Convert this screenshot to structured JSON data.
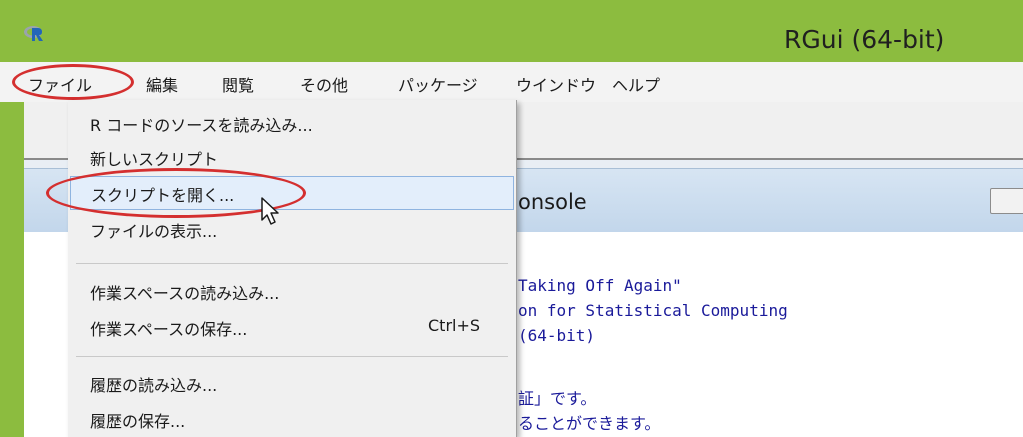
{
  "window": {
    "title": "RGui (64-bit)"
  },
  "menubar": {
    "items": [
      "ファイル",
      "編集",
      "閲覧",
      "その他",
      "パッケージ",
      "ウインドウ",
      "ヘルプ"
    ]
  },
  "file_menu": {
    "items": [
      {
        "label": "R コードのソースを読み込み...",
        "shortcut": ""
      },
      {
        "label": "新しいスクリプト",
        "shortcut": ""
      },
      {
        "label": "スクリプトを開く...",
        "shortcut": ""
      },
      {
        "label": "ファイルの表示...",
        "shortcut": ""
      },
      {
        "label": "作業スペースの読み込み...",
        "shortcut": ""
      },
      {
        "label": "作業スペースの保存...",
        "shortcut": "Ctrl+S"
      },
      {
        "label": "履歴の読み込み...",
        "shortcut": ""
      },
      {
        "label": "履歴の保存...",
        "shortcut": ""
      }
    ],
    "selected_index": 2
  },
  "console": {
    "title": "onsole",
    "lines": [
      "Taking Off Again\"",
      "on for Statistical Computing",
      "(64-bit)",
      "証」です。",
      "ることができます。"
    ]
  },
  "colors": {
    "title_bar": "#8cbc3f",
    "annotation": "#d42f2f",
    "selection": "#e3eefb"
  },
  "icons": {
    "app": "r-logo-icon",
    "cursor": "mouse-pointer-icon"
  }
}
